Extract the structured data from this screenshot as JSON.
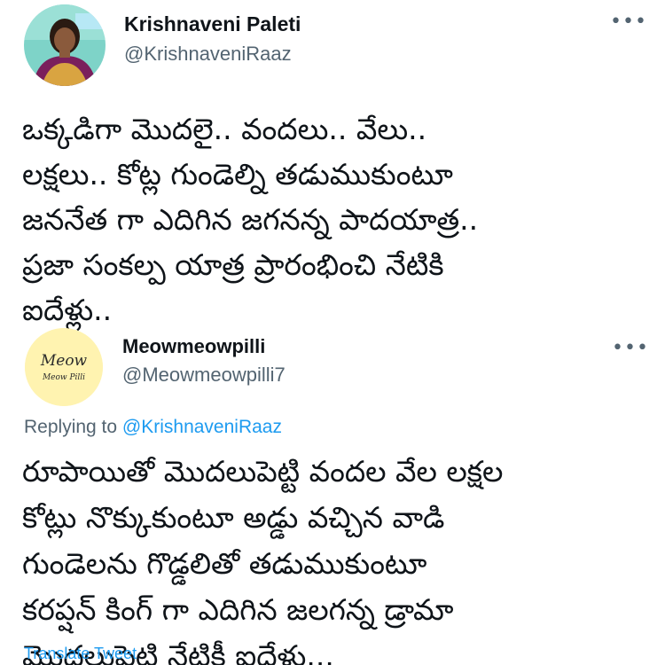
{
  "original_tweet": {
    "author_name": "Krishnaveni Paleti",
    "author_handle": "@KrishnaveniRaaz",
    "more_icon": "more-options-icon",
    "text": "ఒక్కడిగా మొదలై.. వందలు.. వేలు..\nలక్షలు.. కోట్ల గుండెల్ని తడుముకుంటూ\nజననేత గా ఎదిగిన జగనన్న పాదయాత్ర..\nప్రజా సంకల్ప యాత్ర ప్రారంభించి నేటికి\nఐదేళ్లు.."
  },
  "reply_tweet": {
    "author_name": "Meowmeowpilli",
    "author_handle": "@Meowmeowpilli7",
    "more_icon": "more-options-icon",
    "avatar_text_line1": "Meow",
    "avatar_text_line2": "Meow Pilli",
    "replying_to_label": "Replying to",
    "replying_to_handle": "@KrishnaveniRaaz",
    "text": "రూపాయితో మొదలుపెట్టి వందల వేల లక్షల\nకోట్లు నొక్కుకుంటూ అడ్డు వచ్చిన వాడి\nగుండెలను గొడ్డలితో తడుముకుంటూ\nకరప్షన్ కింగ్ గా ఎదిగిన జలగన్న డ్రామా\nమొదలుపెట్టి నేటికీ ఐదేళ్లు...",
    "translate_label": "Translate Tweet"
  },
  "colors": {
    "text_primary": "#0f1419",
    "text_secondary": "#536471",
    "link": "#1d9bf0",
    "meow_avatar_bg": "#fff3b0"
  }
}
